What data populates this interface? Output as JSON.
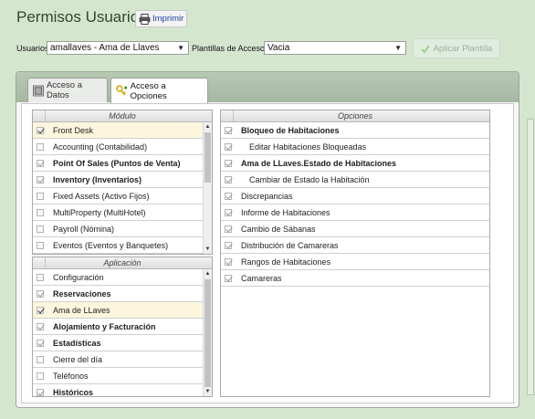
{
  "header": {
    "title": "Permisos Usuarios",
    "print_label": "Imprimir"
  },
  "filters": {
    "user_label": "Usuarios",
    "user_value": "amallaves - Ama de Llaves",
    "templates_label": "Plantillas de Accesos",
    "template_value": "Vacia",
    "apply_label": "Aplicar Plantilla"
  },
  "tabs": [
    {
      "label": "Acceso a Datos"
    },
    {
      "label": "Acceso a Opciones"
    }
  ],
  "modulos": {
    "header": "Módulo",
    "items": [
      {
        "label": "Front Desk",
        "checked": true,
        "selected": true,
        "bold": false
      },
      {
        "label": "Accounting (Contabilidad)",
        "checked": false,
        "selected": false,
        "bold": false
      },
      {
        "label": "Point Of Sales (Puntos de Venta)",
        "checked": true,
        "selected": false,
        "bold": true
      },
      {
        "label": "Inventory (Inventarios)",
        "checked": true,
        "selected": false,
        "bold": true
      },
      {
        "label": "Fixed Assets (Activo Fijos)",
        "checked": false,
        "selected": false,
        "bold": false
      },
      {
        "label": "MultiProperty (MultiHotel)",
        "checked": false,
        "selected": false,
        "bold": false
      },
      {
        "label": "Payroll (Nómina)",
        "checked": false,
        "selected": false,
        "bold": false
      },
      {
        "label": "Eventos (Eventos y Banquetes)",
        "checked": false,
        "selected": false,
        "bold": false
      }
    ]
  },
  "aplicacion": {
    "header": "Aplicación",
    "items": [
      {
        "label": "Configuración",
        "checked": false,
        "selected": false,
        "bold": false
      },
      {
        "label": "Reservaciones",
        "checked": true,
        "selected": false,
        "bold": true
      },
      {
        "label": "Ama de LLaves",
        "checked": true,
        "selected": true,
        "bold": false
      },
      {
        "label": "Alojamiento y Facturación",
        "checked": true,
        "selected": false,
        "bold": true
      },
      {
        "label": "Estadísticas",
        "checked": true,
        "selected": false,
        "bold": true
      },
      {
        "label": "Cierre del día",
        "checked": false,
        "selected": false,
        "bold": false
      },
      {
        "label": "Teléfonos",
        "checked": false,
        "selected": false,
        "bold": false
      },
      {
        "label": "Históricos",
        "checked": true,
        "selected": false,
        "bold": true
      }
    ]
  },
  "opciones": {
    "header": "Opciones",
    "items": [
      {
        "label": "Bloqueo de Habitaciones",
        "checked": true,
        "bold": true,
        "indent": false
      },
      {
        "label": "Editar Habitaciones Bloqueadas",
        "checked": true,
        "bold": false,
        "indent": true
      },
      {
        "label": "Ama de LLaves.Estado de Habitaciones",
        "checked": true,
        "bold": true,
        "indent": false
      },
      {
        "label": "Cambiar de Estado la Habitación",
        "checked": true,
        "bold": false,
        "indent": true
      },
      {
        "label": "Discrepancias",
        "checked": true,
        "bold": false,
        "indent": false
      },
      {
        "label": "Informe de Habitaciones",
        "checked": true,
        "bold": false,
        "indent": false
      },
      {
        "label": "Cambio de Sábanas",
        "checked": true,
        "bold": false,
        "indent": false
      },
      {
        "label": "Distribución de Camareras",
        "checked": true,
        "bold": false,
        "indent": false
      },
      {
        "label": "Rangos de Habitaciones",
        "checked": true,
        "bold": false,
        "indent": false
      },
      {
        "label": "Camareras",
        "checked": true,
        "bold": false,
        "indent": false
      }
    ]
  },
  "icons": {
    "print": "printer-icon",
    "tab_data": "database-icon",
    "tab_options": "key-icon",
    "apply": "check-icon",
    "dropdown": "chevron-down-icon"
  },
  "colors": {
    "background": "#d5e6cf",
    "title": "#2d4a25",
    "link": "#1a3fa0",
    "selected_row": "#fbf6dd"
  }
}
